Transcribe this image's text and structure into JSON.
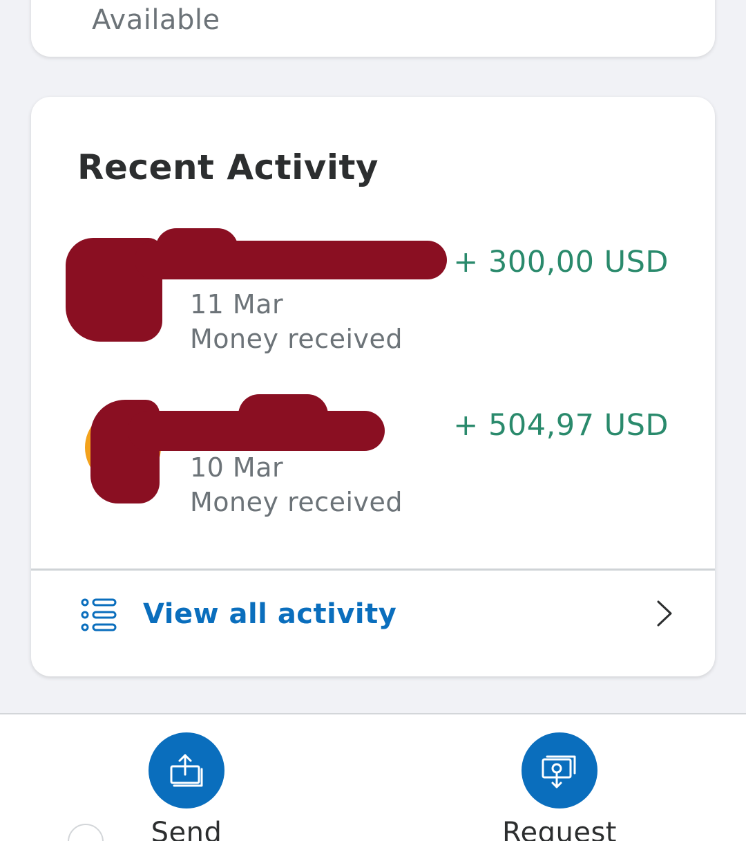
{
  "balance_card": {
    "available_label": "Available"
  },
  "activity": {
    "title": "Recent Activity",
    "transactions": [
      {
        "date": "11 Mar",
        "description": "Money received",
        "amount": "+ 300,00 USD"
      },
      {
        "date": "10 Mar",
        "description": "Money received",
        "amount": "+ 504,97 USD"
      }
    ],
    "view_all_label": "View all activity"
  },
  "bottom_bar": {
    "send_label": "Send",
    "request_label": "Request"
  },
  "colors": {
    "accent_blue": "#0a6ebd",
    "positive_amount": "#2a8a6c",
    "background": "#f1f2f6",
    "redaction": "#8a0f22"
  },
  "icons": {
    "list": "list-icon",
    "chevron": "chevron-right-icon",
    "send": "send-money-icon",
    "request": "request-money-icon"
  }
}
